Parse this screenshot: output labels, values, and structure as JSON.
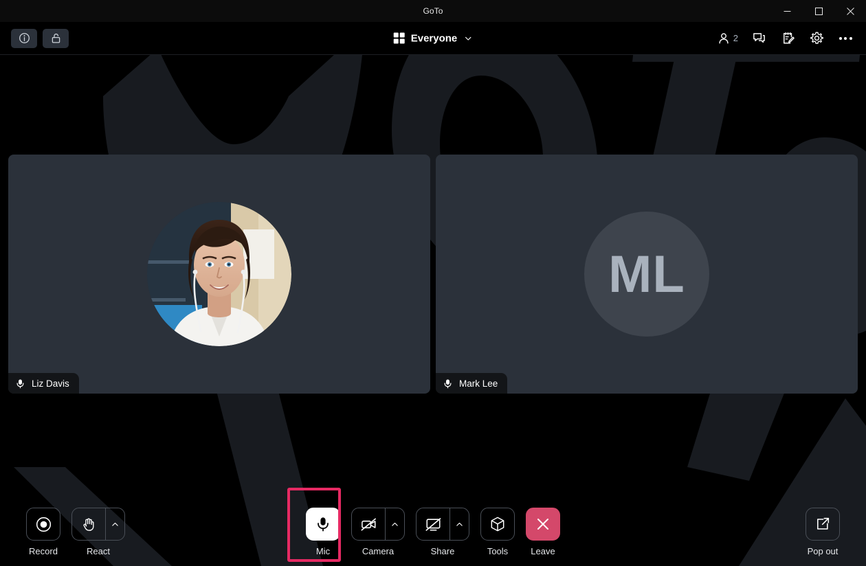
{
  "window": {
    "title": "GoTo",
    "controls": [
      {
        "name": "minimize-button",
        "icon": "minimize-icon"
      },
      {
        "name": "maximize-button",
        "icon": "maximize-icon"
      },
      {
        "name": "close-button",
        "icon": "close-icon"
      }
    ]
  },
  "header": {
    "left_buttons": [
      {
        "name": "meeting-info-button",
        "icon": "info-icon",
        "label": "Meeting information"
      },
      {
        "name": "lock-meeting-button",
        "icon": "unlock-icon",
        "label": "Lock meeting"
      }
    ],
    "view_selector": {
      "icon": "grid-view-icon",
      "label": "Everyone",
      "caret": "chevron-down-icon"
    },
    "right_buttons": [
      {
        "name": "people-button",
        "icon": "person-icon",
        "count": "2"
      },
      {
        "name": "chat-button",
        "icon": "chat-bubble-icon"
      },
      {
        "name": "notes-button",
        "icon": "notes-pencil-icon"
      },
      {
        "name": "settings-button",
        "icon": "gear-icon"
      },
      {
        "name": "more-options-button",
        "icon": "ellipsis-icon"
      }
    ]
  },
  "participants": [
    {
      "name": "Liz Davis",
      "avatar_type": "photo",
      "mic_icon": "mic-icon",
      "muted": false
    },
    {
      "name": "Mark Lee",
      "avatar_type": "initials",
      "initials": "ML",
      "mic_icon": "mic-icon",
      "muted": false
    }
  ],
  "toolbar": {
    "left": [
      {
        "name": "record-button",
        "label": "Record",
        "icon": "record-icon",
        "has_caret": false,
        "state": "default"
      },
      {
        "name": "react-button",
        "label": "React",
        "icon": "raised-hand-icon",
        "has_caret": true,
        "state": "default"
      }
    ],
    "center": [
      {
        "name": "mic-button",
        "label": "Mic",
        "icon": "mic-icon",
        "has_caret": false,
        "state": "active"
      },
      {
        "name": "camera-button",
        "label": "Camera",
        "icon": "camera-off-icon",
        "has_caret": true,
        "state": "default"
      },
      {
        "name": "share-button",
        "label": "Share",
        "icon": "screen-share-off-icon",
        "has_caret": true,
        "state": "default"
      },
      {
        "name": "tools-button",
        "label": "Tools",
        "icon": "cube-icon",
        "has_caret": false,
        "state": "default"
      },
      {
        "name": "leave-button",
        "label": "Leave",
        "icon": "close-x-icon",
        "has_caret": false,
        "state": "danger"
      }
    ],
    "right": [
      {
        "name": "pop-out-button",
        "label": "Pop out",
        "icon": "pop-out-icon",
        "has_caret": false,
        "state": "default"
      }
    ]
  },
  "highlight": {
    "target": "mic-button",
    "color": "#e62a63"
  },
  "colors": {
    "app_background": "#000000",
    "titlebar": "#0c0c0c",
    "tile_background": "#2b313a",
    "avatar_circle": "#3e444d",
    "accent_danger": "#d4486a",
    "highlight": "#e62a63",
    "watermark": "#181b20"
  }
}
